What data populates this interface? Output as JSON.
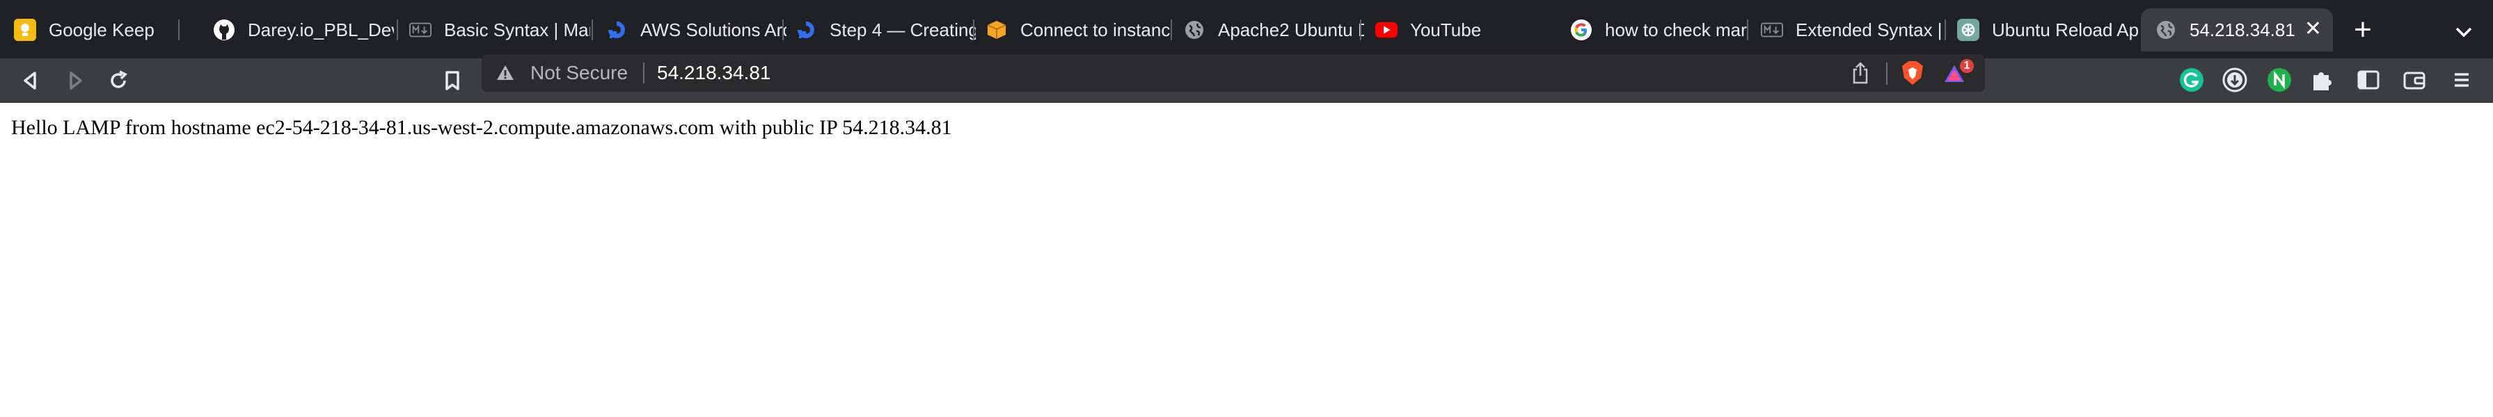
{
  "tabs": [
    {
      "title": "Google Keep",
      "favicon": "google-keep-icon"
    },
    {
      "title": "Darey.io_PBL_Dev",
      "favicon": "github-icon"
    },
    {
      "title": "Basic Syntax | Mar",
      "favicon": "markdown-icon"
    },
    {
      "title": "AWS Solutions Arc",
      "favicon": "digitalocean-icon"
    },
    {
      "title": "Step 4 — Creating",
      "favicon": "digitalocean-icon"
    },
    {
      "title": "Connect to instanc",
      "favicon": "aws-box-icon"
    },
    {
      "title": "Apache2 Ubuntu D",
      "favicon": "globe-icon"
    },
    {
      "title": "YouTube",
      "favicon": "youtube-icon"
    },
    {
      "title": "how to check mar",
      "favicon": "google-icon"
    },
    {
      "title": "Extended Syntax |",
      "favicon": "markdown-icon"
    },
    {
      "title": "Ubuntu Reload Ap",
      "favicon": "openai-icon"
    },
    {
      "title": "54.218.34.81",
      "favicon": "globe-icon",
      "active": true
    }
  ],
  "address_bar": {
    "security_label": "Not Secure",
    "url": "54.218.34.81"
  },
  "extensions": {
    "brave_notification_count": "1"
  },
  "page": {
    "body_text": "Hello LAMP from hostname ec2-54-218-34-81.us-west-2.compute.amazonaws.com with public IP 54.218.34.81"
  },
  "colors": {
    "tabbar_bg": "#202124",
    "toolbar_bg": "#3c3d41",
    "keep_yellow": "#f5ba14",
    "youtube_red": "#ff0000",
    "brave_orange": "#fb542b",
    "grammarly_green": "#15c39a",
    "notion_green": "#1fb14d"
  }
}
